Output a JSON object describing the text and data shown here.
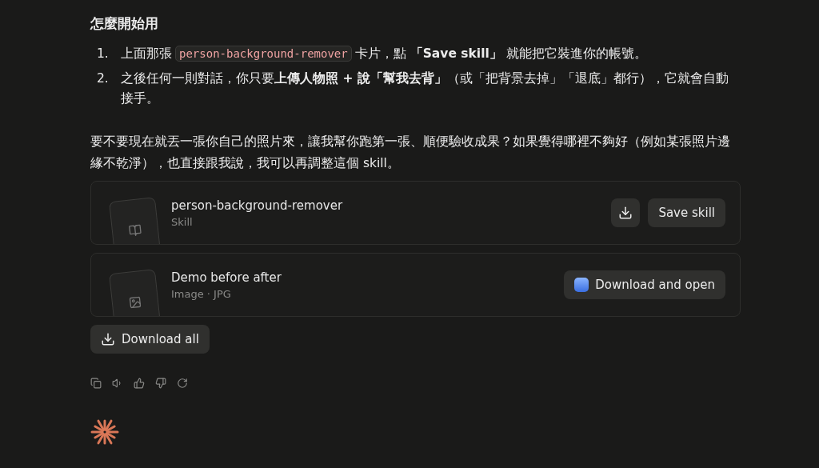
{
  "heading": "怎麼開始用",
  "steps": [
    {
      "number": "1.",
      "parts": [
        {
          "kind": "text",
          "text": "上面那張"
        },
        {
          "kind": "code",
          "text": "person-background-remover"
        },
        {
          "kind": "text",
          "text": "卡片，點 **「Save skill」** 就能把它裝進你的帳號。"
        }
      ]
    },
    {
      "number": "2.",
      "parts": [
        {
          "kind": "text",
          "text": "之後任何一則對話，你只要**上傳人物照 + 說「幫我去背」**（或「把背景去掉」「退底」都行），它就會自動接手。"
        }
      ]
    }
  ],
  "paragraph": "要不要現在就丟一張你自己的照片來，讓我幫你跑第一張、順便驗收成果？如果覺得哪裡不夠好（例如某張照片邊緣不乾淨），也直接跟我說，我可以再調整這個 skill。",
  "files": [
    {
      "kind": "skill",
      "title": "person-background-remover",
      "subtitle": "Skill",
      "buttons": [
        {
          "kind": "download"
        },
        {
          "kind": "text",
          "label": "Save skill"
        }
      ]
    },
    {
      "kind": "image",
      "title": "Demo before after",
      "subtitle": "Image · JPG",
      "buttons": [
        {
          "kind": "app",
          "label": "Download and open"
        }
      ]
    }
  ],
  "download_all": "Download all",
  "actions": [
    {
      "kind": "copy"
    },
    {
      "kind": "speak"
    },
    {
      "kind": "like"
    },
    {
      "kind": "dislike"
    },
    {
      "kind": "retry"
    }
  ]
}
